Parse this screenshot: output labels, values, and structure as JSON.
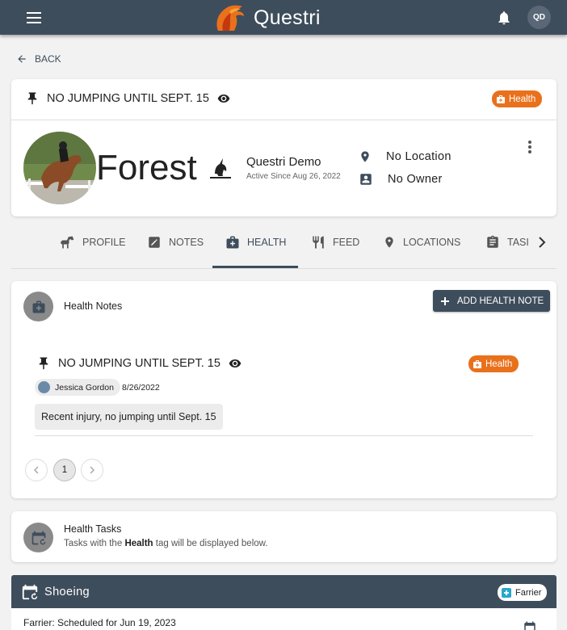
{
  "app": {
    "title": "Questri",
    "user_initials": "QD"
  },
  "nav": {
    "back_label": "BACK"
  },
  "pinned_note": {
    "title": "NO JUMPING UNTIL SEPT. 15",
    "tag": "Health"
  },
  "horse": {
    "name": "Forest",
    "barn_name": "Questri Demo",
    "active_since": "Active Since Aug 26, 2022",
    "location": "No Location",
    "owner": "No Owner"
  },
  "tabs": [
    {
      "label": "PROFILE",
      "icon": "horse-icon"
    },
    {
      "label": "NOTES",
      "icon": "edit-note-icon"
    },
    {
      "label": "HEALTH",
      "icon": "medical-bag-icon",
      "active": true
    },
    {
      "label": "FEED",
      "icon": "utensils-icon"
    },
    {
      "label": "LOCATIONS",
      "icon": "location-pin-icon"
    },
    {
      "label": "TASI",
      "icon": "clipboard-icon"
    }
  ],
  "health_notes": {
    "section_label": "Health Notes",
    "add_button_label": "ADD HEALTH NOTE",
    "note": {
      "title": "NO JUMPING UNTIL SEPT. 15",
      "tag": "Health",
      "author": "Jessica Gordon",
      "date": "8/26/2022",
      "body": "Recent injury, no jumping until Sept. 15"
    },
    "pagination": {
      "current_page": "1"
    }
  },
  "health_tasks": {
    "title": "Health Tasks",
    "sub_prefix": "Tasks with the",
    "sub_tag": "Health",
    "sub_suffix": "tag will be displayed below."
  },
  "shoeing": {
    "title": "Shoeing",
    "tag": "Farrier",
    "schedule_text": "Farrier: Scheduled for Jun 19, 2023"
  },
  "colors": {
    "primary": "#3e4d5c",
    "health_tag": "#e9711c",
    "farrier_tag": "#2aa6c9",
    "background": "#f2f2f2"
  }
}
